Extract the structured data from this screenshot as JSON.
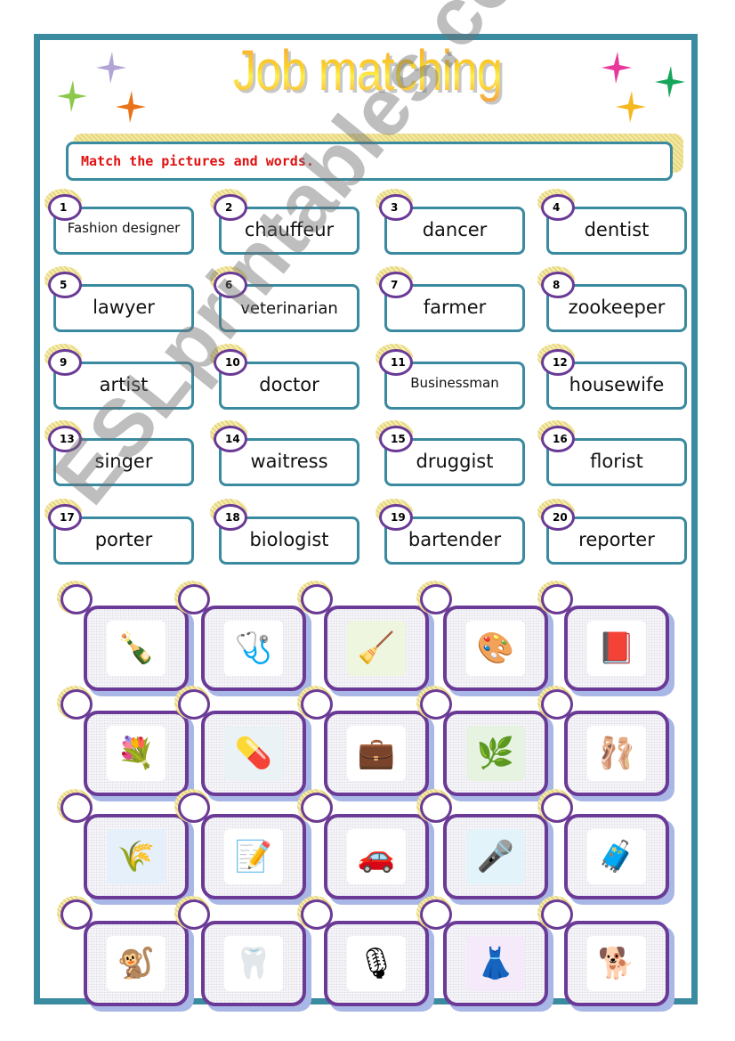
{
  "worksheet": {
    "title": "Job matching",
    "instruction": "Match the pictures and words.",
    "watermark": "ESLprintables.com",
    "colors": {
      "frame_teal": "#3a8aa0",
      "circle_purple": "#6a3a96",
      "instruction_red": "#e01010",
      "title_orange": "#f7a23a",
      "title_yellow": "#fbd227"
    },
    "stars": [
      {
        "side": "left",
        "color": "#b2a4d4"
      },
      {
        "side": "left",
        "color": "#8cc84b"
      },
      {
        "side": "left",
        "color": "#e8731a"
      },
      {
        "side": "right",
        "color": "#e8389a"
      },
      {
        "side": "right",
        "color": "#16a65a"
      },
      {
        "side": "right",
        "color": "#f5b81e"
      }
    ],
    "words": [
      {
        "number": "1",
        "word": "Fashion designer"
      },
      {
        "number": "2",
        "word": "chauffeur"
      },
      {
        "number": "3",
        "word": "dancer"
      },
      {
        "number": "4",
        "word": "dentist"
      },
      {
        "number": "5",
        "word": "lawyer"
      },
      {
        "number": "6",
        "word": "veterinarian"
      },
      {
        "number": "7",
        "word": "farmer"
      },
      {
        "number": "8",
        "word": "zookeeper"
      },
      {
        "number": "9",
        "word": "artist"
      },
      {
        "number": "10",
        "word": "doctor"
      },
      {
        "number": "11",
        "word": "Businessman"
      },
      {
        "number": "12",
        "word": "housewife"
      },
      {
        "number": "13",
        "word": "singer"
      },
      {
        "number": "14",
        "word": "waitress"
      },
      {
        "number": "15",
        "word": "druggist"
      },
      {
        "number": "16",
        "word": "florist"
      },
      {
        "number": "17",
        "word": "porter"
      },
      {
        "number": "18",
        "word": "biologist"
      },
      {
        "number": "19",
        "word": "bartender"
      },
      {
        "number": "20",
        "word": "reporter"
      }
    ],
    "pictures": [
      {
        "depicts": "bartender",
        "glyph": "🍾",
        "answer": ""
      },
      {
        "depicts": "doctor",
        "glyph": "🩺",
        "answer": ""
      },
      {
        "depicts": "housewife",
        "glyph": "🧹",
        "answer": ""
      },
      {
        "depicts": "artist",
        "glyph": "🎨",
        "answer": ""
      },
      {
        "depicts": "lawyer",
        "glyph": "📕",
        "answer": ""
      },
      {
        "depicts": "florist",
        "glyph": "💐",
        "answer": ""
      },
      {
        "depicts": "druggist",
        "glyph": "💊",
        "answer": ""
      },
      {
        "depicts": "businessman",
        "glyph": "💼",
        "answer": ""
      },
      {
        "depicts": "biologist",
        "glyph": "🌿",
        "answer": ""
      },
      {
        "depicts": "dancer",
        "glyph": "🩰",
        "answer": ""
      },
      {
        "depicts": "farmer",
        "glyph": "🌾",
        "answer": ""
      },
      {
        "depicts": "waitress",
        "glyph": "📝",
        "answer": ""
      },
      {
        "depicts": "chauffeur",
        "glyph": "🚗",
        "answer": ""
      },
      {
        "depicts": "reporter",
        "glyph": "🎤",
        "answer": ""
      },
      {
        "depicts": "porter",
        "glyph": "🧳",
        "answer": ""
      },
      {
        "depicts": "zookeeper",
        "glyph": "🐒",
        "answer": ""
      },
      {
        "depicts": "dentist",
        "glyph": "🦷",
        "answer": ""
      },
      {
        "depicts": "singer",
        "glyph": "🎙",
        "answer": ""
      },
      {
        "depicts": "fashion designer",
        "glyph": "👗",
        "answer": ""
      },
      {
        "depicts": "veterinarian",
        "glyph": "🐕",
        "answer": ""
      }
    ]
  }
}
